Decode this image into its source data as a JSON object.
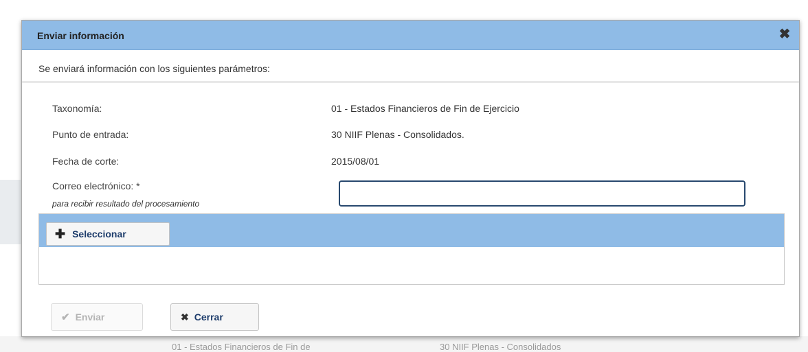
{
  "background": {
    "fragment_left": "01 - Estados Financieros de Fin de",
    "fragment_right": "30 NIIF Plenas - Consolidados"
  },
  "dialog": {
    "title": "Enviar información",
    "intro": "Se enviará información con los siguientes parámetros:",
    "fields": [
      {
        "label": "Taxonomía:",
        "value": "01 - Estados Financieros de Fin de Ejercicio"
      },
      {
        "label": "Punto de entrada:",
        "value": "30 NIIF Plenas - Consolidados."
      },
      {
        "label": "Fecha de corte:",
        "value": "2015/08/01"
      }
    ],
    "email": {
      "label": "Correo electrónico: *",
      "hint": "para recibir resultado del procesamiento",
      "value": "",
      "placeholder": ""
    },
    "upload": {
      "select_label": "Seleccionar"
    },
    "buttons": {
      "send_label": "Enviar",
      "close_label": "Cerrar"
    }
  }
}
